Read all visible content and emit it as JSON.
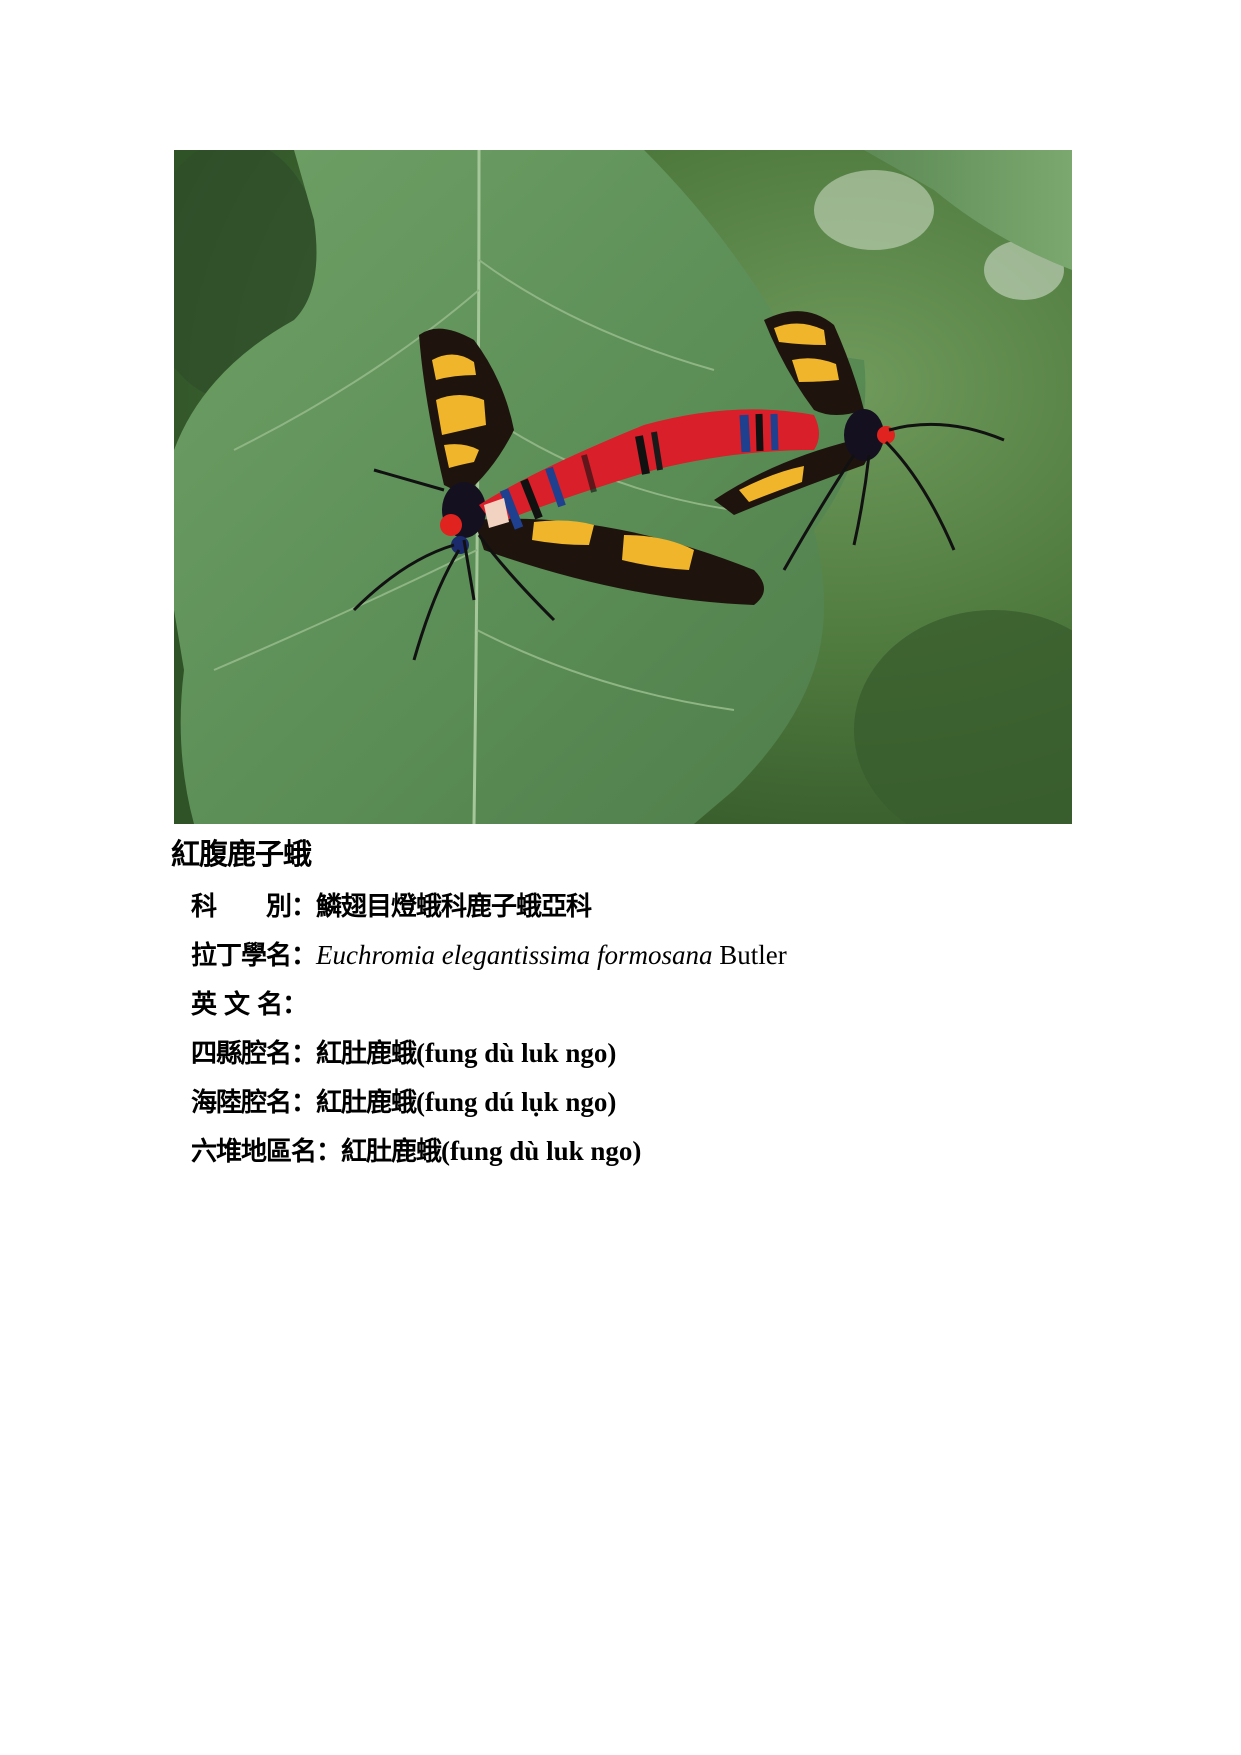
{
  "document": {
    "title": "紅腹鹿子蛾",
    "photo": {
      "icon": "moth-photo-icon"
    },
    "rows": [
      {
        "label": "科　　別：",
        "cjk": "鱗翅目燈蛾科鹿子蛾亞科",
        "latin": ""
      },
      {
        "label": "拉丁學名：",
        "italic": "Euchromia elegantissima formosana",
        "plain": " Butler"
      },
      {
        "label": "英 文 名：",
        "cjk": "",
        "latin": ""
      },
      {
        "label": "四縣腔名：",
        "cjk": "紅肚鹿蛾",
        "latin": "(fung dù luk ngo)"
      },
      {
        "label": "海陸腔名：",
        "cjk": "紅肚鹿蛾",
        "latin": "(fung dú lụk ngo)"
      },
      {
        "label": "六堆地區名：",
        "cjk": "紅肚鹿蛾",
        "latin": "(fung dù luk ngo)"
      }
    ]
  }
}
